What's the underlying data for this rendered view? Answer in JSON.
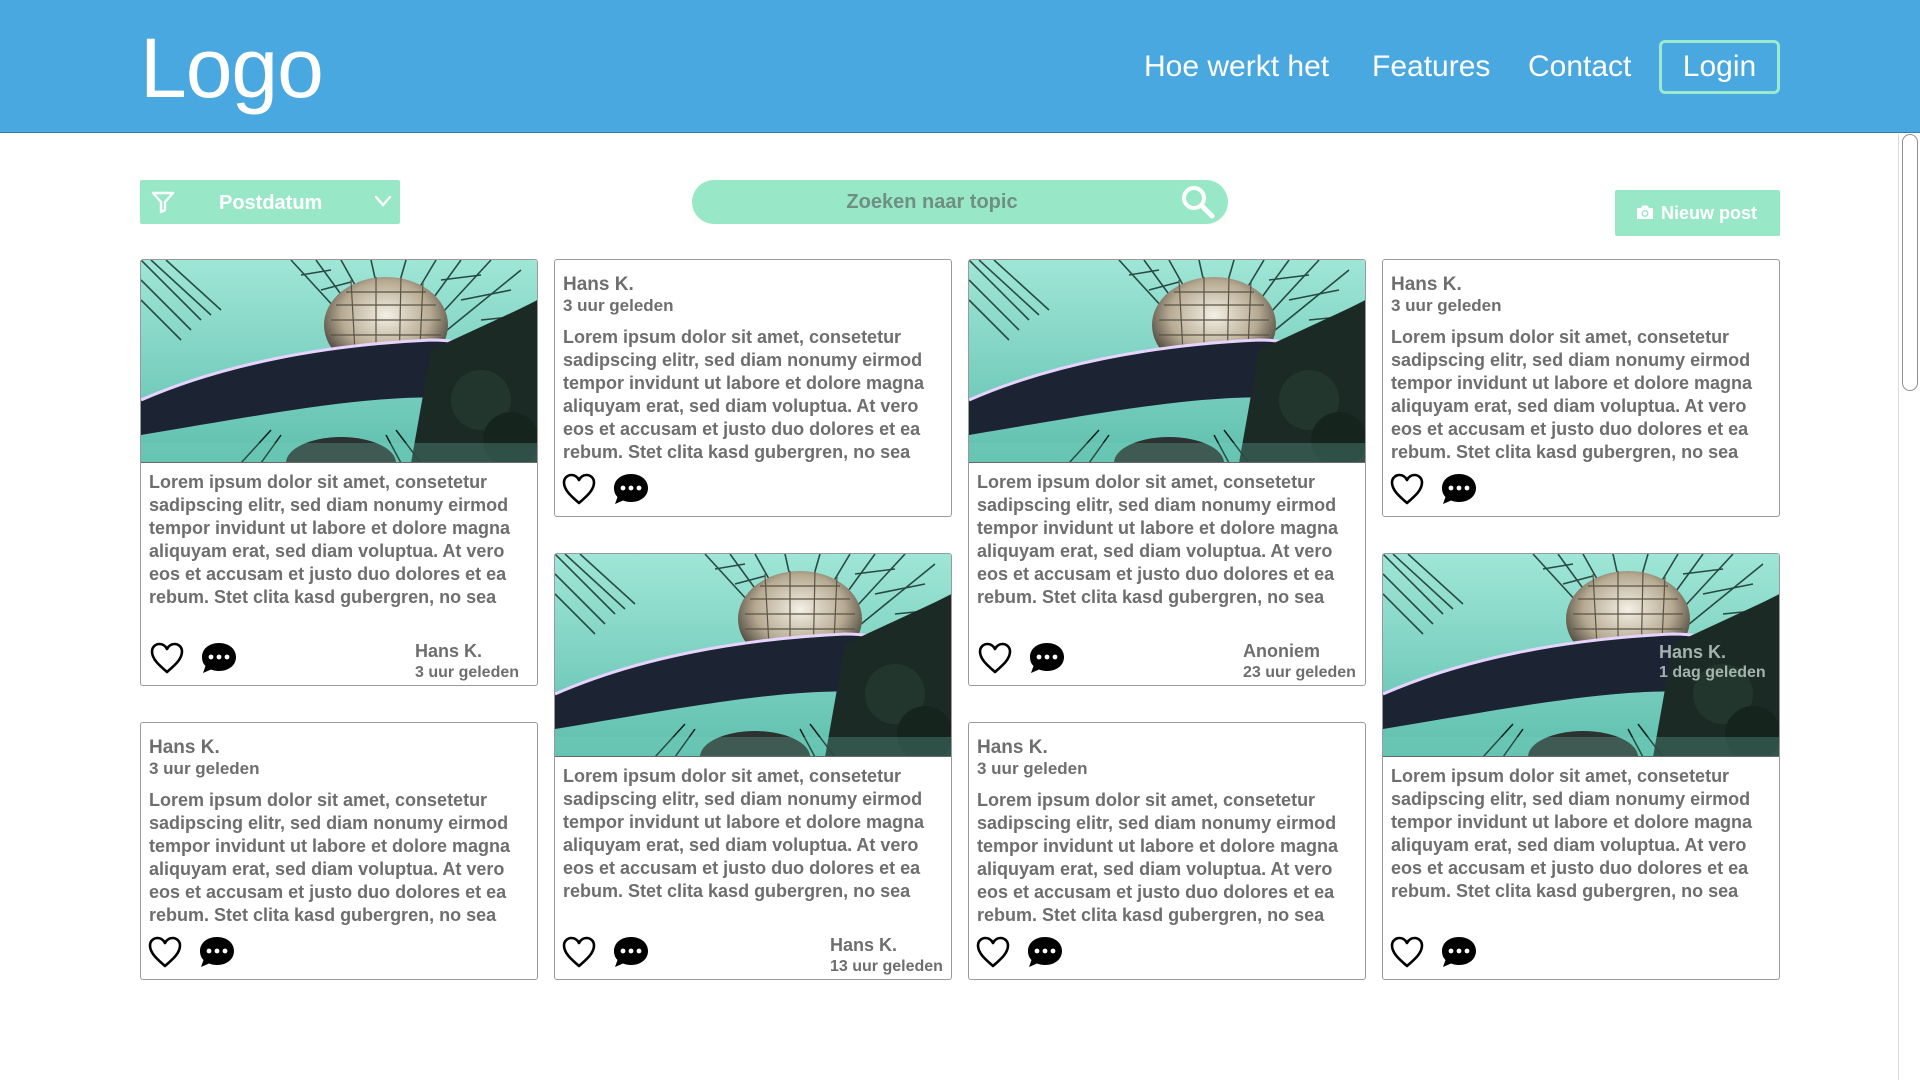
{
  "header": {
    "logo": "Logo",
    "nav": [
      "Hoe werkt het",
      "Features",
      "Contact"
    ],
    "login": "Login",
    "bg_color": "#4aa8e0"
  },
  "toolbar": {
    "filter_label": "Postdatum",
    "search_placeholder": "Zoeken naar topic",
    "new_post_label": "Nieuw post",
    "accent_color": "#98e8c8"
  },
  "lorem": "Lorem ipsum dolor sit amet, consetetur sadipscing elitr, sed diam nonumy eirmod tempor invidunt ut labore et dolore magna aliquyam erat, sed diam voluptua. At vero eos et accusam et justo duo dolores et ea rebum. Stet clita kasd gubergren, no sea",
  "posts": [
    {
      "type": "image",
      "author": "Hans K.",
      "time": "3 uur geleden",
      "text": "Lorem ipsum dolor sit amet, consetetur sadipscing elitr, sed diam nonumy eirmod tempor invidunt ut labore et dolore magna aliquyam erat, sed diam voluptua. At vero eos et accusam et justo duo dolores et ea rebum. Stet clita kasd gubergren, no sea"
    },
    {
      "type": "text",
      "author": "Hans K.",
      "time": "3 uur geleden",
      "text": "Lorem ipsum dolor sit amet, consetetur sadipscing elitr, sed diam nonumy eirmod tempor invidunt ut labore et dolore magna aliquyam erat, sed diam voluptua. At vero eos et accusam et justo duo dolores et ea rebum. Stet clita kasd gubergren, no sea"
    },
    {
      "type": "image",
      "author": "Anoniem",
      "time": "23 uur geleden",
      "text": "Lorem ipsum dolor sit amet, consetetur sadipscing elitr, sed diam nonumy eirmod tempor invidunt ut labore et dolore magna aliquyam erat, sed diam voluptua. At vero eos et accusam et justo duo dolores et ea rebum. Stet clita kasd gubergren, no sea"
    },
    {
      "type": "text",
      "author": "Hans K.",
      "time": "3 uur geleden",
      "text": "Lorem ipsum dolor sit amet, consetetur sadipscing elitr, sed diam nonumy eirmod tempor invidunt ut labore et dolore magna aliquyam erat, sed diam voluptua. At vero eos et accusam et justo duo dolores et ea rebum. Stet clita kasd gubergren, no sea"
    },
    {
      "type": "text",
      "author": "Hans K.",
      "time": "3 uur geleden",
      "text": "Lorem ipsum dolor sit amet, consetetur sadipscing elitr, sed diam nonumy eirmod tempor invidunt ut labore et dolore magna aliquyam erat, sed diam voluptua. At vero eos et accusam et justo duo dolores et ea rebum. Stet clita kasd gubergren, no sea"
    },
    {
      "type": "image",
      "author": "Hans K.",
      "time": "13 uur geleden",
      "text": "Lorem ipsum dolor sit amet, consetetur sadipscing elitr, sed diam nonumy eirmod tempor invidunt ut labore et dolore magna aliquyam erat, sed diam voluptua. At vero eos et accusam et justo duo dolores et ea rebum. Stet clita kasd gubergren, no sea"
    },
    {
      "type": "text",
      "author": "Hans K.",
      "time": "3 uur geleden",
      "text": "Lorem ipsum dolor sit amet, consetetur sadipscing elitr, sed diam nonumy eirmod tempor invidunt ut labore et dolore magna aliquyam erat, sed diam voluptua. At vero eos et accusam et justo duo dolores et ea rebum. Stet clita kasd gubergren, no sea"
    },
    {
      "type": "image",
      "author": "Hans K.",
      "time": "1 dag geleden",
      "text": "Lorem ipsum dolor sit amet, consetetur sadipscing elitr, sed diam nonumy eirmod tempor invidunt ut labore et dolore magna aliquyam erat, sed diam voluptua. At vero eos et accusam et justo duo dolores et ea rebum. Stet clita kasd gubergren, no sea"
    }
  ],
  "icons": {
    "filter": "filter-icon",
    "dropdown": "chevron-down-icon",
    "search": "search-icon",
    "camera": "camera-icon",
    "like": "heart-icon",
    "comment": "comment-icon"
  }
}
